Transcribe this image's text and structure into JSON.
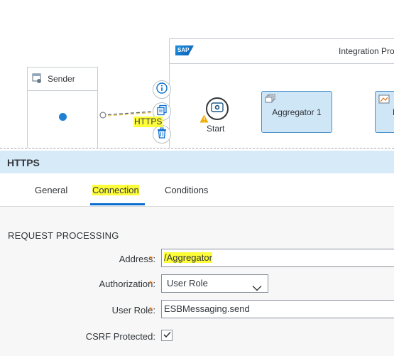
{
  "canvas": {
    "sender_label": "Sender",
    "pool_title": "Integration Process",
    "sap_logo_text": "SAP",
    "start_label": "Start",
    "connector_label": "HTTPS",
    "steps": [
      {
        "label": "Aggregator 1"
      },
      {
        "label": "M"
      }
    ],
    "context_icons": [
      "info-icon",
      "copy-icon",
      "delete-icon"
    ]
  },
  "panel": {
    "title": "HTTPS",
    "tabs": [
      {
        "label": "General"
      },
      {
        "label": "Connection"
      },
      {
        "label": "Conditions"
      }
    ],
    "active_tab": "Connection",
    "section_title": "REQUEST PROCESSING",
    "fields": {
      "address": {
        "label": "Address:",
        "required": "*",
        "value": "/Aggregator"
      },
      "authorization": {
        "label": "Authorization:",
        "required": "*",
        "value": "User Role"
      },
      "user_role": {
        "label": "User Role:",
        "required": "*",
        "value": "ESBMessaging.send"
      },
      "csrf": {
        "label": "CSRF Protected:",
        "checked": true
      }
    }
  },
  "colors": {
    "highlight": "#fdfd3a",
    "step_fill": "#cfe6f7",
    "step_border": "#4d90c7",
    "header_bg": "#d7eaf8",
    "tab_underline": "#0a6ed1",
    "required": "#e9730c"
  }
}
